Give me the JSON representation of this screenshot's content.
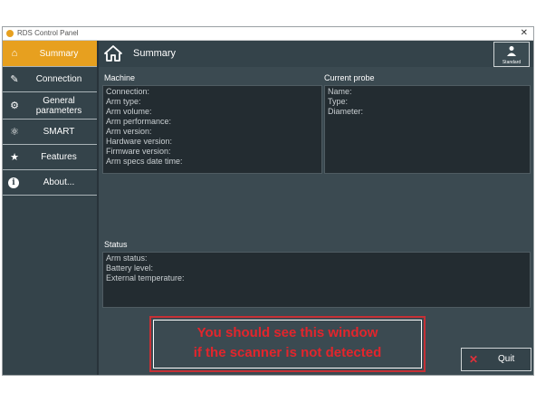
{
  "window": {
    "title": "RDS Control Panel",
    "close_glyph": "✕"
  },
  "sidebar": {
    "items": [
      {
        "label": "Summary",
        "icon": "home-icon",
        "glyph": "⌂",
        "active": true
      },
      {
        "label": "Connection",
        "icon": "plug-icon",
        "glyph": "✎",
        "active": false
      },
      {
        "label": "General parameters",
        "icon": "gear-icon",
        "glyph": "⚙",
        "active": false
      },
      {
        "label": "SMART",
        "icon": "smart-icon",
        "glyph": "⚛",
        "active": false
      },
      {
        "label": "Features",
        "icon": "star-icon",
        "glyph": "★",
        "active": false
      },
      {
        "label": "About...",
        "icon": "info-icon",
        "glyph": "i",
        "active": false
      }
    ]
  },
  "header": {
    "title": "Summary",
    "mode_button_label": "Standard"
  },
  "machine": {
    "label": "Machine",
    "fields": [
      "Connection:",
      "Arm type:",
      "Arm volume:",
      "Arm performance:",
      "Arm version:",
      "Hardware version:",
      "Firmware version:",
      "Arm specs date time:"
    ]
  },
  "probe": {
    "label": "Current probe",
    "fields": [
      "Name:",
      "Type:",
      "Diameter:"
    ]
  },
  "status": {
    "label": "Status",
    "fields": [
      "Arm status:",
      "Battery level:",
      "External temperature:"
    ]
  },
  "quit": {
    "label": "Quit",
    "glyph": "✕"
  },
  "callout": {
    "line1": "You should see this window",
    "line2": "if the scanner is not detected"
  },
  "colors": {
    "accent": "#e7a01f",
    "panel_bg": "#34434a",
    "callout_red": "#e3252c"
  }
}
